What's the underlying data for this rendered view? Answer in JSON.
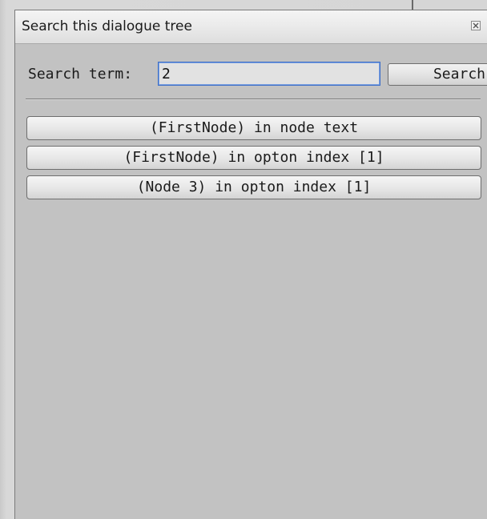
{
  "window": {
    "title": "Search this dialogue tree"
  },
  "search": {
    "label": "Search term:",
    "value": "2",
    "button_label": "Search"
  },
  "results": [
    {
      "label": "(FirstNode) in node text"
    },
    {
      "label": "(FirstNode) in opton index [1]"
    },
    {
      "label": "(Node 3) in opton index [1]"
    }
  ],
  "colors": {
    "window_bg": "#c2c2c2",
    "input_focus_border": "#3b6ec9",
    "titlebar_bg": "#ebebeb"
  },
  "icons": {
    "close": "close-icon"
  }
}
